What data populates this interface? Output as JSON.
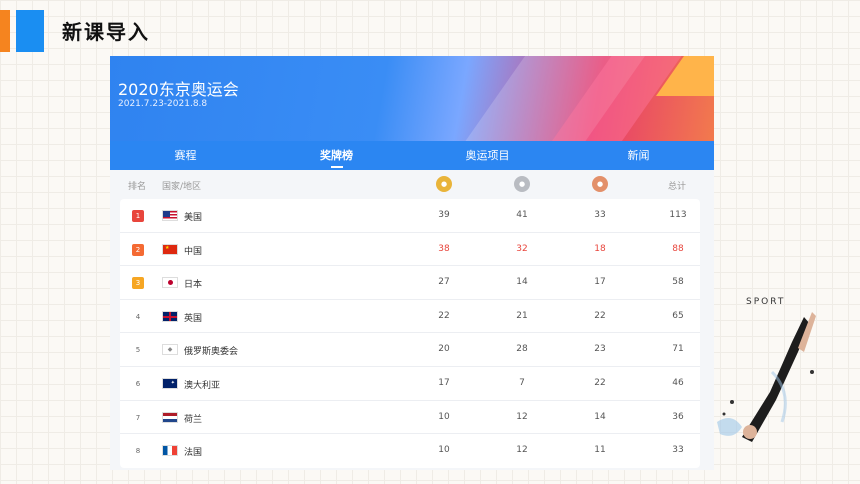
{
  "slide": {
    "title": "新课导入"
  },
  "banner": {
    "title": "2020东京奥运会",
    "date": "2021.7.23-2021.8.8"
  },
  "tabs": [
    {
      "label": "赛程",
      "active": false
    },
    {
      "label": "奖牌榜",
      "active": true
    },
    {
      "label": "奥运项目",
      "active": false
    },
    {
      "label": "新闻",
      "active": false
    }
  ],
  "table": {
    "headers": {
      "rank": "排名",
      "country": "国家/地区",
      "total": "总计"
    },
    "medal_icons": [
      "gold-medal-icon",
      "silver-medal-icon",
      "bronze-medal-icon"
    ],
    "rows": [
      {
        "rank": "1",
        "country": "美国",
        "gold": "39",
        "silver": "41",
        "bronze": "33",
        "total": "113"
      },
      {
        "rank": "2",
        "country": "中国",
        "gold": "38",
        "silver": "32",
        "bronze": "18",
        "total": "88"
      },
      {
        "rank": "3",
        "country": "日本",
        "gold": "27",
        "silver": "14",
        "bronze": "17",
        "total": "58"
      },
      {
        "rank": "4",
        "country": "英国",
        "gold": "22",
        "silver": "21",
        "bronze": "22",
        "total": "65"
      },
      {
        "rank": "5",
        "country": "俄罗斯奥委会",
        "gold": "20",
        "silver": "28",
        "bronze": "23",
        "total": "71"
      },
      {
        "rank": "6",
        "country": "澳大利亚",
        "gold": "17",
        "silver": "7",
        "bronze": "22",
        "total": "46"
      },
      {
        "rank": "7",
        "country": "荷兰",
        "gold": "10",
        "silver": "12",
        "bronze": "14",
        "total": "36"
      },
      {
        "rank": "8",
        "country": "法国",
        "gold": "10",
        "silver": "12",
        "bronze": "11",
        "total": "33"
      }
    ]
  },
  "colors": {
    "accent_blue": "#2b86f2",
    "accent_orange": "#f5841f",
    "highlight_red": "#e8453c"
  },
  "decoration": {
    "text": "SPORT"
  }
}
